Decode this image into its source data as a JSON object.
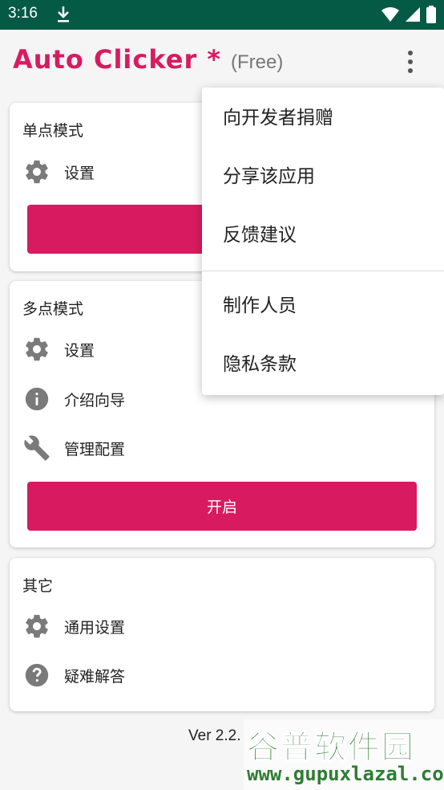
{
  "status_bar": {
    "time": "3:16",
    "icons": [
      "download-icon",
      "wifi-icon",
      "signal-icon",
      "battery-icon"
    ]
  },
  "app_bar": {
    "title": "Auto Clicker *",
    "subtitle": "(Free)",
    "overflow_icon": "more-vert-icon"
  },
  "single_mode": {
    "title": "单点模式",
    "settings_label": "设置"
  },
  "multi_mode": {
    "title": "多点模式",
    "settings_label": "设置",
    "guide_label": "介绍向导",
    "manage_label": "管理配置",
    "start_label": "开启"
  },
  "other": {
    "title": "其它",
    "general_settings_label": "通用设置",
    "faq_label": "疑难解答"
  },
  "version": "Ver 2.2.",
  "overflow_menu": {
    "items": [
      "向开发者捐赠",
      "分享该应用",
      "反馈建议",
      "制作人员",
      "隐私条款"
    ]
  },
  "watermark": {
    "name": "谷普软件园",
    "url": "www.gupuxlazal.com"
  },
  "colors": {
    "accent": "#d81b60",
    "status_bar": "#055a45",
    "icon_gray": "#7a7a7a"
  }
}
